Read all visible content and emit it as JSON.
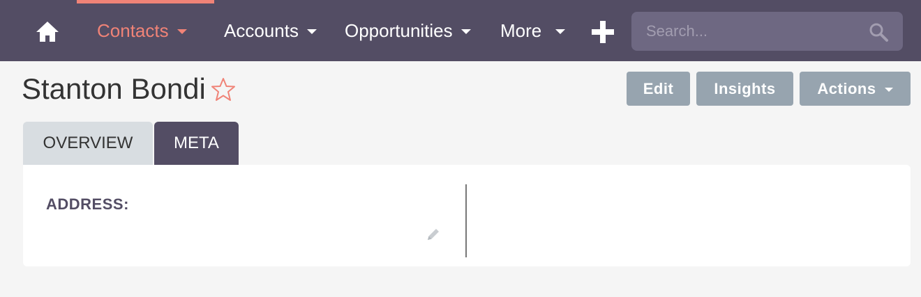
{
  "nav": {
    "home_icon": "home-icon",
    "items": [
      {
        "label": "Contacts",
        "active": true
      },
      {
        "label": "Accounts",
        "active": false
      },
      {
        "label": "Opportunities",
        "active": false
      },
      {
        "label": "More",
        "active": false
      }
    ],
    "create_icon": "plus-icon",
    "search": {
      "placeholder": "Search...",
      "value": "",
      "icon": "search-icon"
    }
  },
  "record": {
    "title": "Stanton Bondi",
    "favorite_icon": "star-icon"
  },
  "actions": {
    "edit": "Edit",
    "insights": "Insights",
    "actions": "Actions"
  },
  "tabs": [
    {
      "label": "OVERVIEW",
      "active": false
    },
    {
      "label": "META",
      "active": true
    }
  ],
  "panel": {
    "address_label": "ADDRESS:",
    "address_value": "",
    "edit_icon": "pencil-icon"
  },
  "colors": {
    "nav_bg": "#534d64",
    "accent": "#f08377",
    "button_bg": "#97a4af",
    "tab_inactive": "#d8dde1",
    "page_bg": "#f5f5f5"
  }
}
